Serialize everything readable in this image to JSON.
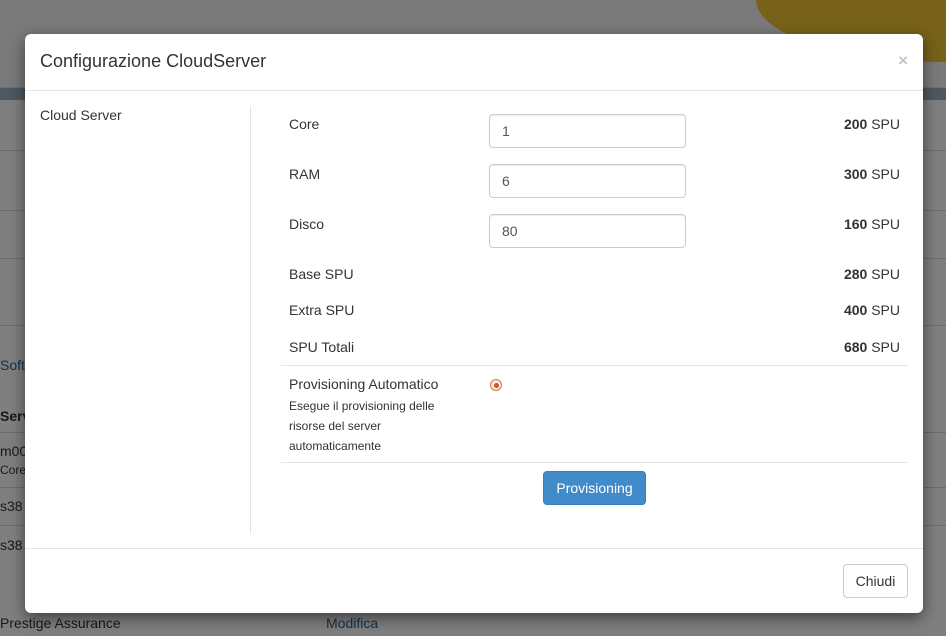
{
  "background": {
    "link_soft": "Soft",
    "heading_serv": "Serv",
    "row1_name": "m00",
    "row1_sub": "Core",
    "row2_name": "s38",
    "row3_name": "s38",
    "bottom_label": "Prestige Assurance",
    "bottom_link": "Modifica"
  },
  "modal": {
    "title": "Configurazione CloudServer",
    "close_glyph": "×",
    "left_label": "Cloud Server",
    "rows": {
      "core": {
        "label": "Core",
        "input_value": "1",
        "value": "200",
        "unit": " SPU"
      },
      "ram": {
        "label": "RAM",
        "input_value": "6",
        "value": "300",
        "unit": " SPU"
      },
      "disco": {
        "label": "Disco",
        "input_value": "80",
        "value": "160",
        "unit": " SPU"
      },
      "base": {
        "label": "Base SPU",
        "value": "280",
        "unit": " SPU"
      },
      "extra": {
        "label": "Extra SPU",
        "value": "400",
        "unit": " SPU"
      },
      "totali": {
        "label": "SPU Totali",
        "value": "680",
        "unit": " SPU"
      }
    },
    "provisioning": {
      "title": "Provisioning Automatico",
      "description": "Esegue il provisioning delle risorse del server automaticamente",
      "checked": true
    },
    "provisioning_button": "Provisioning",
    "close_button": "Chiudi"
  },
  "colors": {
    "primary": "#428bca",
    "radio_accent": "#c85a2f",
    "swoosh": "#f1c232"
  }
}
